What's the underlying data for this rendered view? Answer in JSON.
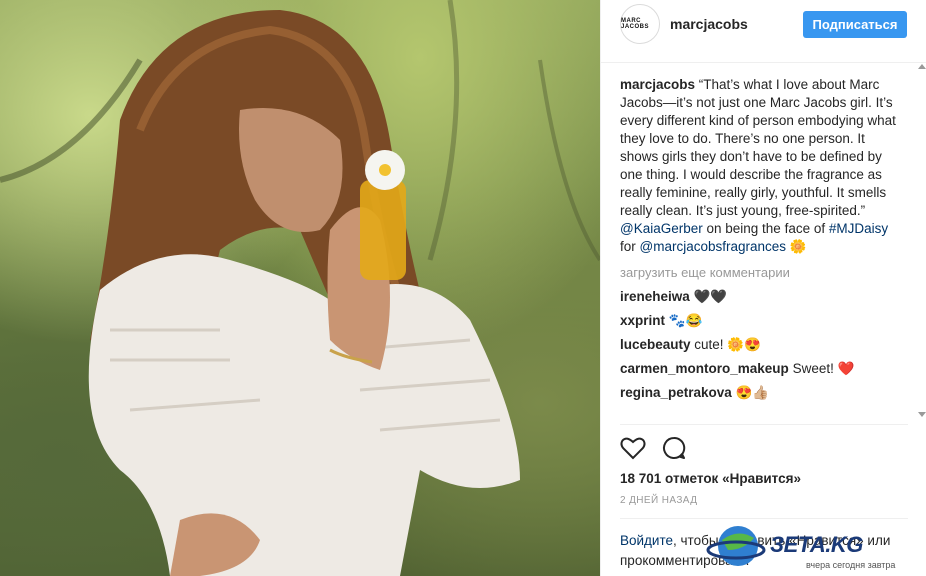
{
  "post": {
    "image_alt_icon": "photo-woman-with-perfume"
  },
  "header": {
    "avatar_text": "MARC JACOBS",
    "username": "marcjacobs",
    "follow_label": "Подписаться"
  },
  "caption": {
    "username": "marcjacobs",
    "text": " “That’s what I love about Marc Jacobs—it’s not just one Marc Jacobs girl. It’s every different kind of person embodying what they love to do. There’s no one person. It shows girls they don’t have to be defined by one thing. I would describe the fragrance as really feminine, really girly, youthful. It smells really clean. It’s just young, free-spirited.” ",
    "mention": "@KaiaGerber",
    "text2": " on being the face of ",
    "hashtag": "#MJDaisy",
    "text3": " for ",
    "mention2": "@marcjacobsfragrances",
    "emoji": "🌼"
  },
  "load_more": "загрузить еще комментарии",
  "comments": [
    {
      "user": "ireneheiwa",
      "text": " 🖤🖤"
    },
    {
      "user": "xxprint",
      "text": " 🐾😂"
    },
    {
      "user": "lucebeauty",
      "text": " cute! 🌼😍"
    },
    {
      "user": "carmen_montoro_makeup",
      "text": " Sweet! ❤️"
    },
    {
      "user": "regina_petrakova",
      "text": " 😍👍🏼"
    }
  ],
  "likes": "18 701 отметок «Нравится»",
  "time": "2 ДНЕЙ НАЗАД",
  "login": {
    "link": "Войдите",
    "text": ", чтобы поставить «Нравится» или прокомментировать."
  },
  "watermark": {
    "text": "ЗЕТА.KG",
    "sub": "вчера сегодня завтра"
  },
  "colors": {
    "accent": "#3897f0",
    "link": "#003569",
    "heart": "#ed4956"
  }
}
